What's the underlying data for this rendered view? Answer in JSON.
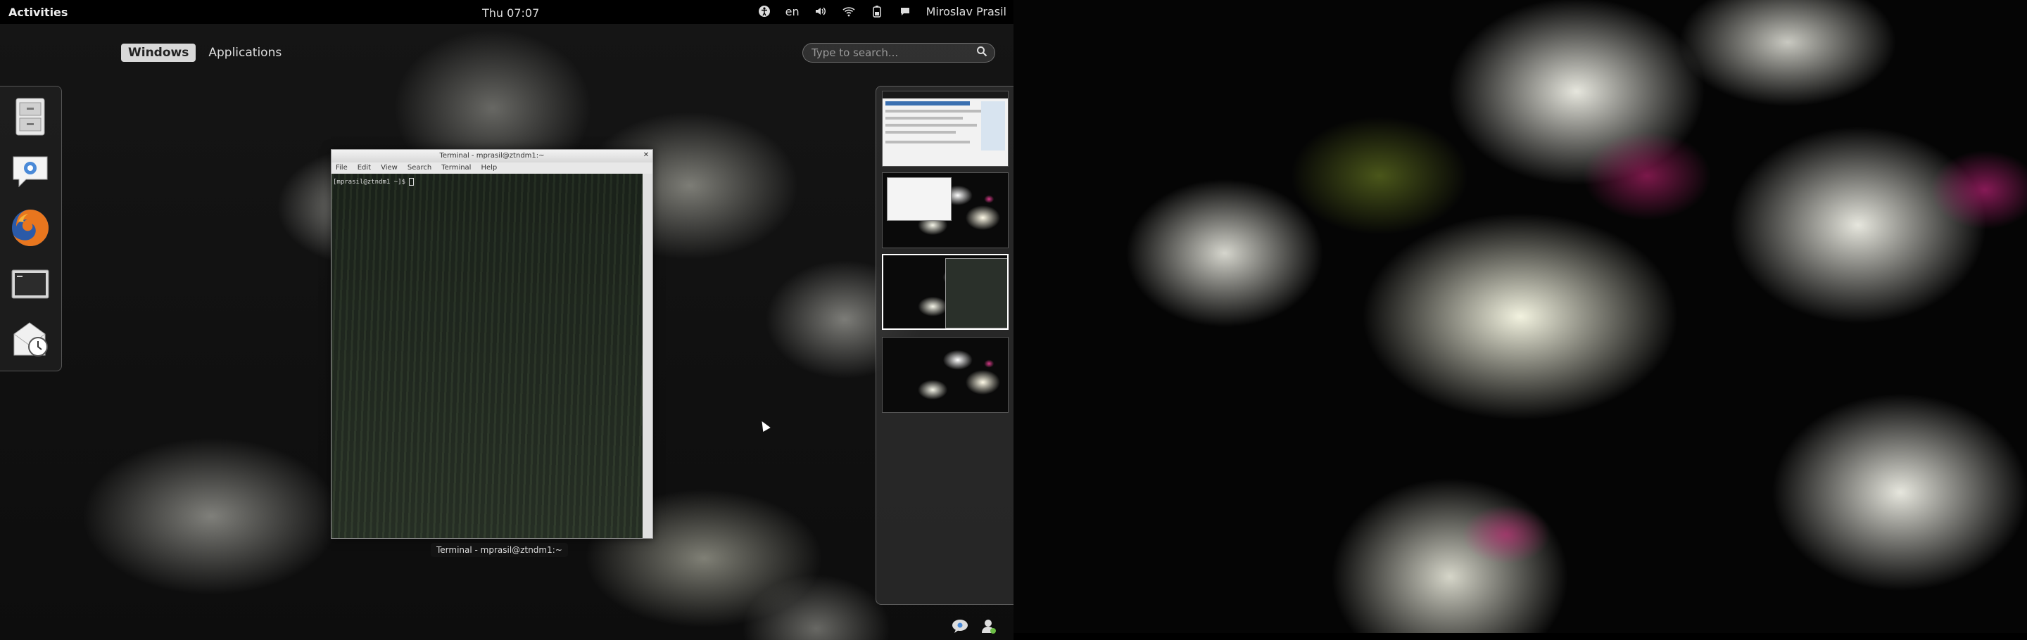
{
  "top_bar": {
    "activities_label": "Activities",
    "clock": "Thu 07:07",
    "status_icons": [
      "accessibility-icon",
      "keyboard-layout",
      "volume-icon",
      "wifi-icon",
      "battery-icon"
    ],
    "keyboard_layout": "en",
    "user_name": "Miroslav Prasil"
  },
  "overview": {
    "view_tabs": [
      {
        "label": "Windows",
        "active": true
      },
      {
        "label": "Applications",
        "active": false
      }
    ],
    "search_placeholder": "Type to search..."
  },
  "dash": {
    "items": [
      "file-cabinet-icon",
      "empathy-chat-icon",
      "firefox-icon",
      "terminal-icon",
      "mail-clock-icon"
    ]
  },
  "terminal_window": {
    "title": "Terminal - mprasil@ztndm1:~",
    "menu": [
      "File",
      "Edit",
      "View",
      "Search",
      "Terminal",
      "Help"
    ],
    "prompt": "[mprasil@ztndm1 ~]$ ",
    "caption": "Terminal - mprasil@ztndm1:~"
  },
  "workspaces": {
    "count": 4,
    "active_index": 2
  },
  "tray": {
    "items": [
      "chat-bubble-icon",
      "user-presence-icon"
    ]
  },
  "colors": {
    "panel_bg": "#000000",
    "active_tab_bg": "#d8d8d8",
    "highlight": "#d83a88"
  }
}
